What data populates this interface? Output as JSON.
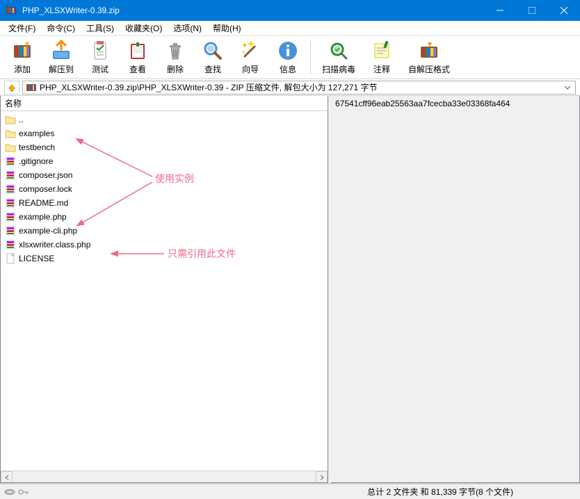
{
  "window": {
    "title": "PHP_XLSXWriter-0.39.zip"
  },
  "menu": {
    "file": "文件(F)",
    "cmd": "命令(C)",
    "tools": "工具(S)",
    "fav": "收藏夹(O)",
    "opts": "选项(N)",
    "help": "帮助(H)"
  },
  "toolbar": {
    "add": "添加",
    "extract": "解压到",
    "test": "测试",
    "view": "查看",
    "delete": "删除",
    "find": "查找",
    "wizard": "向导",
    "info": "信息",
    "scan": "扫描病毒",
    "comment": "注释",
    "sfx": "自解压格式"
  },
  "path": {
    "text": "PHP_XLSXWriter-0.39.zip\\PHP_XLSXWriter-0.39 - ZIP 压缩文件, 解包大小为 127,271 字节"
  },
  "columns": {
    "name": "名称"
  },
  "files": [
    {
      "name": "..",
      "type": "up"
    },
    {
      "name": "examples",
      "type": "folder"
    },
    {
      "name": "testbench",
      "type": "folder"
    },
    {
      "name": ".gitignore",
      "type": "rar"
    },
    {
      "name": "composer.json",
      "type": "rar"
    },
    {
      "name": "composer.lock",
      "type": "rar"
    },
    {
      "name": "README.md",
      "type": "rar"
    },
    {
      "name": "example.php",
      "type": "rar"
    },
    {
      "name": "example-cli.php",
      "type": "rar"
    },
    {
      "name": "xlsxwriter.class.php",
      "type": "rar"
    },
    {
      "name": "LICENSE",
      "type": "file"
    }
  ],
  "right": {
    "content": "67541cff96eab25563aa7fcecba33e03368fa464"
  },
  "status": {
    "text": "总计 2 文件夹 和 81,339 字节(8 个文件)"
  },
  "annotations": {
    "a1": "使用实例",
    "a2": "只需引用此文件"
  }
}
